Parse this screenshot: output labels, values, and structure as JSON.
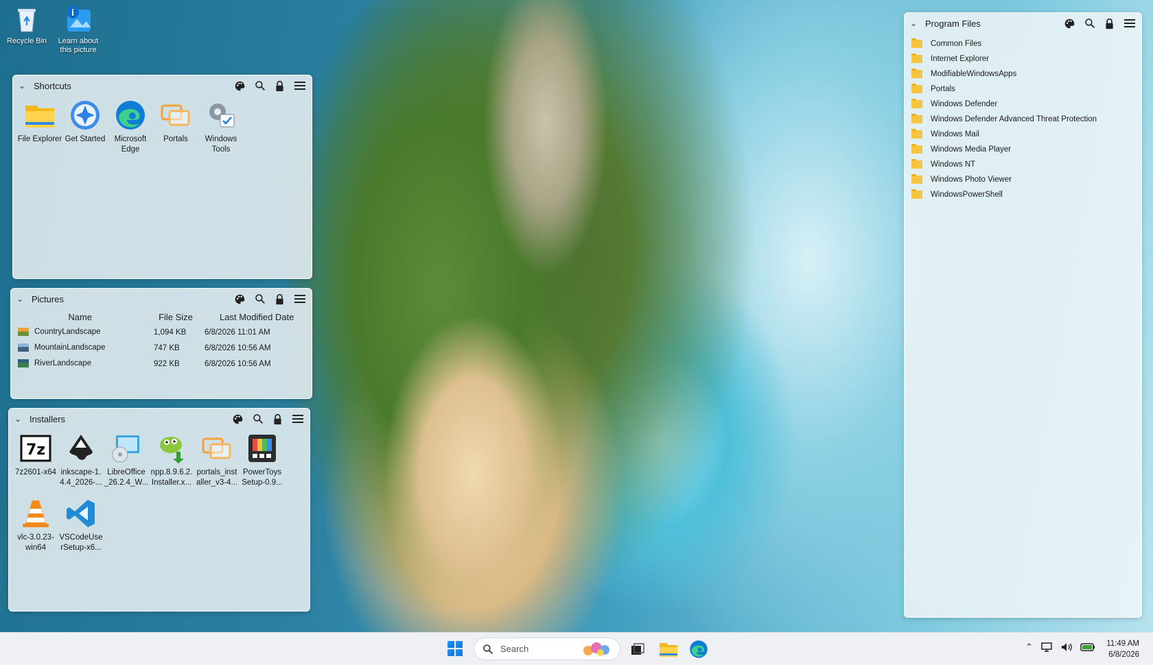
{
  "desktop": {
    "icons": [
      {
        "label": "Recycle Bin",
        "icon": "recycle-bin-icon"
      },
      {
        "label": "Learn about this picture",
        "icon": "learn-about-picture-icon"
      }
    ]
  },
  "fences": {
    "shortcuts": {
      "title": "Shortcuts",
      "items": [
        {
          "label": "File Explorer",
          "icon": "file-explorer-icon"
        },
        {
          "label": "Get Started",
          "icon": "get-started-icon"
        },
        {
          "label": "Microsoft Edge",
          "icon": "edge-icon"
        },
        {
          "label": "Portals",
          "icon": "portals-icon"
        },
        {
          "label": "Windows Tools",
          "icon": "windows-tools-icon"
        }
      ]
    },
    "pictures": {
      "title": "Pictures",
      "columns": [
        "Name",
        "File Size",
        "Last Modified Date"
      ],
      "rows": [
        {
          "name": "CountryLandscape",
          "size": "1,094 KB",
          "date": "6/8/2026 11:01 AM"
        },
        {
          "name": "MountainLandscape",
          "size": "747 KB",
          "date": "6/8/2026 10:56 AM"
        },
        {
          "name": "RiverLandscape",
          "size": "922 KB",
          "date": "6/8/2026 10:56 AM"
        }
      ]
    },
    "installers": {
      "title": "Installers",
      "items": [
        {
          "label": "7z2601-x64",
          "icon": "7zip-icon"
        },
        {
          "label": "inkscape-1. 4.4_2026-...",
          "icon": "inkscape-icon"
        },
        {
          "label": "LibreOffice _26.2.4_W...",
          "icon": "libreoffice-installer-icon"
        },
        {
          "label": "npp.8.9.6.2. Installer.x...",
          "icon": "notepad-plus-plus-icon"
        },
        {
          "label": "portals_inst aller_v3-4...",
          "icon": "portals-icon"
        },
        {
          "label": "PowerToys Setup-0.9...",
          "icon": "powertoys-icon"
        },
        {
          "label": "vlc-3.0.23- win64",
          "icon": "vlc-icon"
        },
        {
          "label": "VSCodeUse rSetup-x6...",
          "icon": "vscode-icon"
        }
      ]
    },
    "program_files": {
      "title": "Program Files",
      "folders": [
        "Common Files",
        "Internet Explorer",
        "ModifiableWindowsApps",
        "Portals",
        "Windows Defender",
        "Windows Defender Advanced Threat Protection",
        "Windows Mail",
        "Windows Media Player",
        "Windows NT",
        "Windows Photo Viewer",
        "WindowsPowerShell"
      ]
    }
  },
  "taskbar": {
    "search_placeholder": "Search",
    "time": "11:49 AM",
    "date": "6/8/2026"
  },
  "colors": {
    "fence_bg": "#f4f6f8",
    "folder": "#f5c542",
    "accent": "#0c6fd8"
  }
}
